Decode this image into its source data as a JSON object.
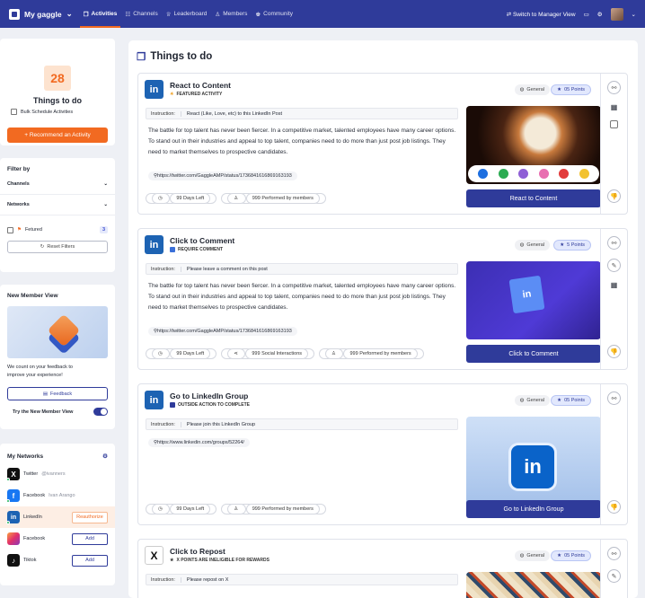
{
  "topbar": {
    "brand": "My gaggle",
    "nav": [
      {
        "label": "Activities",
        "active": true
      },
      {
        "label": "Channels",
        "active": false
      },
      {
        "label": "Leaderboard",
        "active": false
      },
      {
        "label": "Members",
        "active": false
      },
      {
        "label": "Community",
        "active": false
      }
    ],
    "switch_label": "Switch to Manager View"
  },
  "sidebar": {
    "todo_count": "28",
    "todo_title": "Things to do",
    "bulk_label": "Bulk Schedule Activities",
    "recommend_label": "+ Recommend an Activity",
    "filter_title": "Filter by",
    "filters": [
      "Channels",
      "Networks"
    ],
    "featured_label": "Fetured",
    "featured_count": "3",
    "reset_label": "Reset Filters",
    "nmv_title": "New Member View",
    "nmv_text_1": "We count on your feedback to",
    "nmv_text_2": "improve your experience!",
    "feedback_label": "Feedback",
    "try_label": "Try the New Member View",
    "networks_title": "My Networks",
    "networks": [
      {
        "name": "Twitter",
        "sub": "@ivanners",
        "color": "#111111",
        "glyph": "X",
        "button": ""
      },
      {
        "name": "Facebook",
        "sub": "Ivan Arango",
        "color": "#1877f2",
        "glyph": "f",
        "button": ""
      },
      {
        "name": "LinkedIn",
        "sub": "",
        "color": "#1d63b3",
        "glyph": "in",
        "button": "Reauthorize"
      },
      {
        "name": "Facebook",
        "sub": "",
        "color": "#e1306c",
        "glyph": "◎",
        "button": "Add"
      },
      {
        "name": "Tiktok",
        "sub": "",
        "color": "#111111",
        "glyph": "♪",
        "button": "Add"
      }
    ]
  },
  "main": {
    "title": "Things to do",
    "activities": [
      {
        "title": "React to Content",
        "tag": "FEATURED ACTIVITY",
        "category": "General",
        "points": "05 Points",
        "instruction_label": "Instruction:",
        "instruction": "React (Like, Love, etc) to this LinkedIn Post",
        "description": "The battle for top talent has never been fiercer. In a competitive market, talented employees have many career options. To stand out in their industries and appeal to top talent, companies need to do more than just post job listings. They need to market themselves to prospective candidates.",
        "link": "https://twitter.com/GaggleAMP/status/1736841616869163193",
        "meta": [
          "99 Days Left",
          "999 Performed by members"
        ],
        "cta": "React to Content"
      },
      {
        "title": "Click to Comment",
        "tag": "REQUIRE COMMENT",
        "category": "General",
        "points": "5 Points",
        "instruction_label": "Instruction:",
        "instruction": "Please leave a comment on this post",
        "description": "The battle for top talent has never been fiercer. In a competitive market, talented employees have many career options. To stand out in their industries and appeal to top talent, companies need to do more than just post job listings. They need to market themselves to prospective candidates.",
        "link": "https://twitter.com/GaggleAMP/status/1736841616869163193",
        "meta": [
          "99 Days Left",
          "999 Social Interactions",
          "999 Performed by members"
        ],
        "cta": "Click to Comment"
      },
      {
        "title": "Go to LinkedIn Group",
        "tag": "OUTSIDE ACTION TO COMPLETE",
        "category": "General",
        "points": "05 Points",
        "instruction_label": "Instruction:",
        "instruction": "Please join this LinkedIn Group",
        "link": "https://www.linkedin.com/groups/52264/",
        "meta": [
          "99 Days Left",
          "999 Performed by members"
        ],
        "cta": "Go to LinkedIn Group"
      },
      {
        "title": "Click to Repost",
        "tag": "X POINTS ARE INELIGIBLE FOR REWARDS",
        "category": "General",
        "points": "05 Points",
        "instruction_label": "Instruction:",
        "instruction": "Please repost on X"
      }
    ]
  },
  "colors": {
    "primary": "#2f3b9a",
    "accent": "#f26a21"
  }
}
